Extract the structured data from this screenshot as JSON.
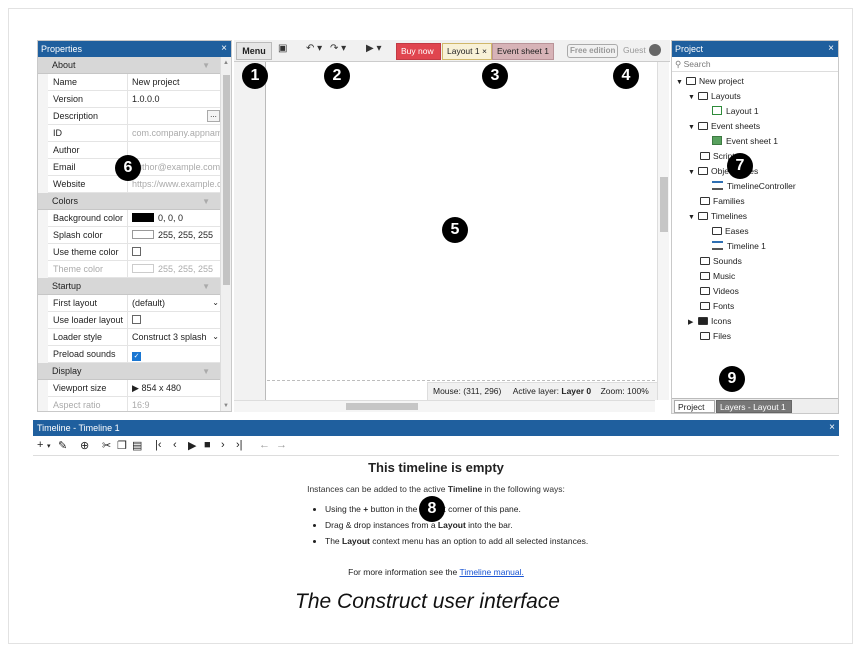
{
  "properties": {
    "title": "Properties",
    "close": "×",
    "sections": [
      {
        "label": "About",
        "rows": [
          {
            "key": "Name",
            "value": "New project"
          },
          {
            "key": "Version",
            "value": "1.0.0.0"
          },
          {
            "key": "Description",
            "value": "",
            "button": "..."
          },
          {
            "key": "ID",
            "value": "com.company.appname",
            "grey": true
          },
          {
            "key": "Author",
            "value": ""
          },
          {
            "key": "Email",
            "value": "author@example.com",
            "grey": true
          },
          {
            "key": "Website",
            "value": "https://www.example.com",
            "grey": true
          }
        ]
      },
      {
        "label": "Colors",
        "rows": [
          {
            "key": "Background color",
            "value": "0, 0, 0"
          },
          {
            "key": "Splash color",
            "value": "255, 255, 255"
          },
          {
            "key": "Use theme color",
            "value": ""
          },
          {
            "key": "Theme color",
            "value": "255, 255, 255"
          }
        ]
      },
      {
        "label": "Startup",
        "rows": [
          {
            "key": "First layout",
            "value": "(default)"
          },
          {
            "key": "Use loader layout",
            "value": ""
          },
          {
            "key": "Loader style",
            "value": "Construct 3 splash"
          },
          {
            "key": "Preload sounds",
            "value": ""
          }
        ]
      },
      {
        "label": "Display",
        "rows": [
          {
            "key": "Viewport size",
            "value": "854 x 480"
          },
          {
            "key": "Aspect ratio",
            "value": "16:9"
          }
        ]
      }
    ],
    "colors": {
      "background": "#000000",
      "splash": "#ffffff",
      "theme": "#ffffff"
    },
    "preload_sounds_checked": true
  },
  "toolbar": {
    "menu": "Menu",
    "tabs": [
      {
        "label": "Buy now"
      },
      {
        "label": "Layout 1",
        "close": "×"
      },
      {
        "label": "Event sheet 1",
        "close": "×"
      }
    ],
    "free_edition": "Free edition",
    "guest": "Guest"
  },
  "layout_view": {
    "status": {
      "mouse": "Mouse: (311, 296)",
      "active_layer_label": "Active layer:",
      "active_layer": "Layer 0",
      "zoom": "Zoom: 100%"
    }
  },
  "project": {
    "title": "Project",
    "close": "×",
    "search_placeholder": "Search",
    "tree": {
      "root": "New project",
      "layouts": "Layouts",
      "layout_1": "Layout 1",
      "event_sheets": "Event sheets",
      "event_sheet_1": "Event sheet 1",
      "scripts": "Scripts",
      "object_types": "Object types",
      "timeline_controller": "TimelineController",
      "families": "Families",
      "timelines": "Timelines",
      "eases": "Eases",
      "timeline_1": "Timeline 1",
      "sounds": "Sounds",
      "music": "Music",
      "videos": "Videos",
      "fonts": "Fonts",
      "icons": "Icons",
      "files": "Files"
    },
    "bottom_tabs": [
      {
        "label": "Project",
        "close": "×"
      },
      {
        "label": "Layers - Layout 1",
        "close": "×"
      }
    ]
  },
  "timeline": {
    "title": "Timeline - Timeline 1",
    "close": "×",
    "heading": "This timeline is empty",
    "intro_pre": "Instances can be added to the active ",
    "intro_bold": "Timeline",
    "intro_post": " in the following ways:",
    "bullets": [
      {
        "pre": "Using the ",
        "bold": "+",
        "post": " button in the top-left corner of this pane."
      },
      {
        "pre": "Drag & drop instances from a ",
        "bold": "Layout",
        "post": " into the bar."
      },
      {
        "pre": "The ",
        "bold": "Layout",
        "post": " context menu has an option to add all selected instances."
      }
    ],
    "more_pre": "For more information see the ",
    "more_link": "Timeline manual."
  },
  "caption": "The Construct user interface",
  "markers": [
    "1",
    "2",
    "3",
    "4",
    "5",
    "6",
    "7",
    "8",
    "9"
  ],
  "icons": {
    "save": "save-icon",
    "undo": "undo-icon",
    "redo": "redo-icon",
    "play": "play-icon",
    "user": "user-icon",
    "search": "search-icon",
    "folder": "folder-icon"
  }
}
